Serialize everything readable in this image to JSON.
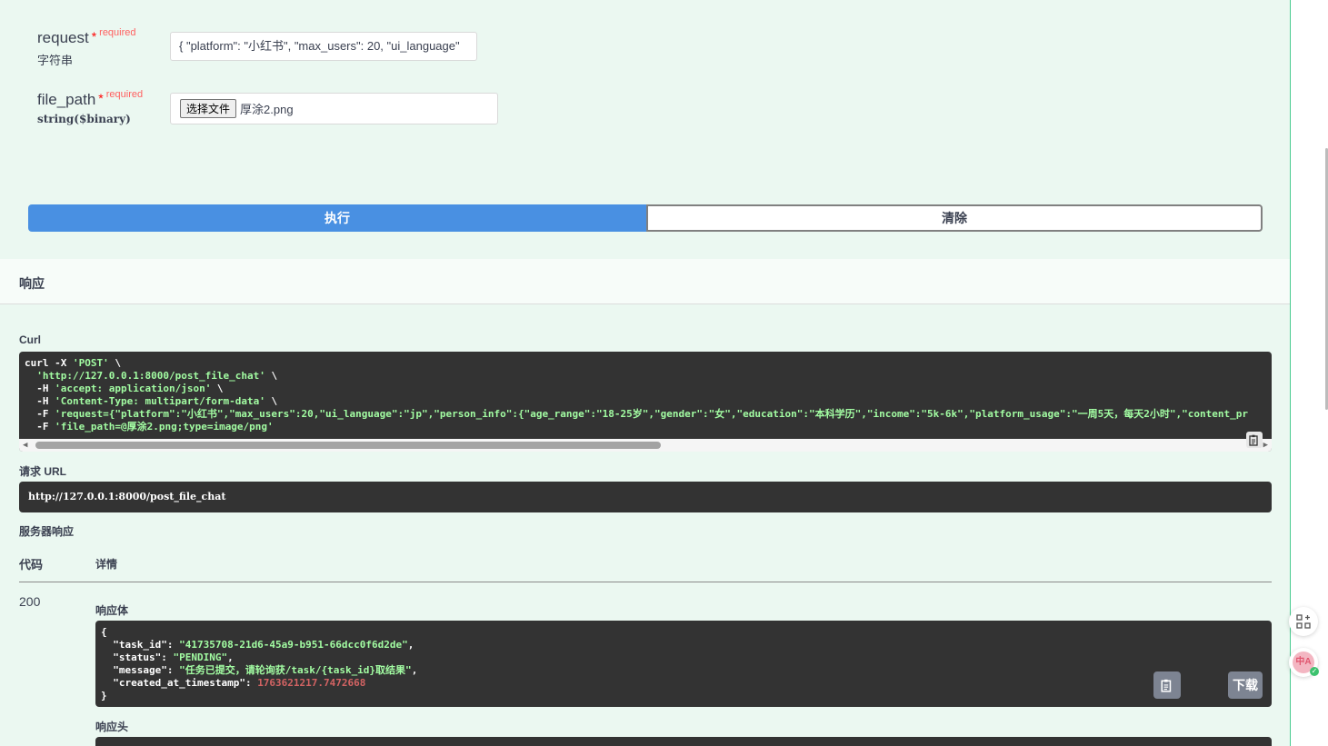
{
  "params": [
    {
      "name": "request",
      "star": "*",
      "required": "required",
      "type": "字符串",
      "value": "{ \"platform\": \"小红书\", \"max_users\": 20, \"ui_language\""
    },
    {
      "name": "file_path",
      "star": "*",
      "required": "required",
      "type": "string($binary)",
      "file_button": "选择文件",
      "file_name": "厚涂2.png"
    }
  ],
  "buttons": {
    "execute": "执行",
    "clear": "清除"
  },
  "responses": {
    "title": "响应",
    "curl_label": "Curl",
    "curl_lines": [
      {
        "cmd": "curl -X ",
        "str": "'POST'",
        "tail": " \\"
      },
      {
        "cmd": "  ",
        "str": "'http://127.0.0.1:8000/post_file_chat'",
        "tail": " \\"
      },
      {
        "cmd": "  -H ",
        "str": "'accept: application/json'",
        "tail": " \\"
      },
      {
        "cmd": "  -H ",
        "str": "'Content-Type: multipart/form-data'",
        "tail": " \\"
      },
      {
        "cmd": "  -F ",
        "str": "'request={\"platform\":\"小红书\",\"max_users\":20,\"ui_language\":\"jp\",\"person_info\":{\"age_range\":\"18-25岁\",\"gender\":\"女\",\"education\":\"本科学历\",\"income\":\"5k-6k\",\"platform_usage\":\"一周5天，每天2小时\",\"content_pr",
        "tail": ""
      },
      {
        "cmd": "  -F ",
        "str": "'file_path=@厚涂2.png;type=image/png'",
        "tail": ""
      }
    ],
    "request_url_label": "请求 URL",
    "request_url": "http://127.0.0.1:8000/post_file_chat",
    "server_response_label": "服务器响应",
    "col_code": "代码",
    "col_details": "详情",
    "code": "200",
    "body_label": "响应体",
    "body": {
      "open": "{",
      "task_id_key": "  \"task_id\": ",
      "task_id": "\"41735708-21d6-45a9-b951-66dcc0f6d2de\"",
      "status_key": "  \"status\": ",
      "status": "\"PENDING\"",
      "message_key": "  \"message\": ",
      "message": "\"任务已提交，请轮询获/task/{task_id}取结果\"",
      "created_key": "  \"created_at_timestamp\": ",
      "created": "1763621217.7472668",
      "close": "}",
      "comma": ","
    },
    "download": "下载",
    "headers_label": "响应头"
  },
  "rail": {
    "avatar_text": "中A",
    "check": "✓"
  }
}
